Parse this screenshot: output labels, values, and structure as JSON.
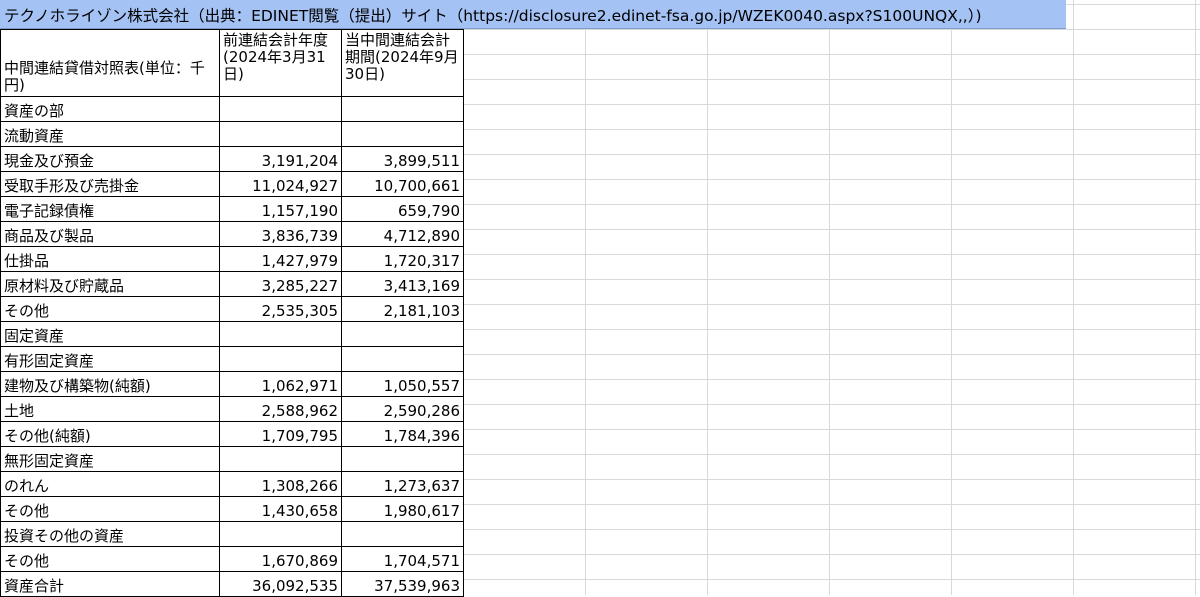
{
  "title_bar": {
    "text": "テクノホライゾン株式会社（出典：EDINET閲覧（提出）サイト（https://disclosure2.edinet-fsa.go.jp/WZEK0040.aspx?S100UNQX,,）)"
  },
  "sheet": {
    "headers": [
      "中間連結貸借対照表(単位：千円)",
      "前連結会計年度(2024年3月31日)",
      "当中間連結会計期間(2024年9月30日)"
    ],
    "rows": [
      {
        "label": "資産の部",
        "prior": "",
        "current": ""
      },
      {
        "label": "流動資産",
        "prior": "",
        "current": ""
      },
      {
        "label": "現金及び預金",
        "prior": "3,191,204",
        "current": "3,899,511"
      },
      {
        "label": "受取手形及び売掛金",
        "prior": "11,024,927",
        "current": "10,700,661"
      },
      {
        "label": "電子記録債権",
        "prior": "1,157,190",
        "current": "659,790"
      },
      {
        "label": "商品及び製品",
        "prior": "3,836,739",
        "current": "4,712,890"
      },
      {
        "label": "仕掛品",
        "prior": "1,427,979",
        "current": "1,720,317"
      },
      {
        "label": "原材料及び貯蔵品",
        "prior": "3,285,227",
        "current": "3,413,169"
      },
      {
        "label": "その他",
        "prior": "2,535,305",
        "current": "2,181,103"
      },
      {
        "label": "固定資産",
        "prior": "",
        "current": ""
      },
      {
        "label": "有形固定資産",
        "prior": "",
        "current": ""
      },
      {
        "label": "建物及び構築物(純額)",
        "prior": "1,062,971",
        "current": "1,050,557"
      },
      {
        "label": "土地",
        "prior": "2,588,962",
        "current": "2,590,286"
      },
      {
        "label": "その他(純額)",
        "prior": "1,709,795",
        "current": "1,784,396"
      },
      {
        "label": "無形固定資産",
        "prior": "",
        "current": ""
      },
      {
        "label": "のれん",
        "prior": "1,308,266",
        "current": "1,273,637"
      },
      {
        "label": "その他",
        "prior": "1,430,658",
        "current": "1,980,617"
      },
      {
        "label": "投資その他の資産",
        "prior": "",
        "current": ""
      },
      {
        "label": "その他",
        "prior": "1,670,869",
        "current": "1,704,571"
      },
      {
        "label": "資産合計",
        "prior": "36,092,535",
        "current": "37,539,963"
      }
    ]
  }
}
